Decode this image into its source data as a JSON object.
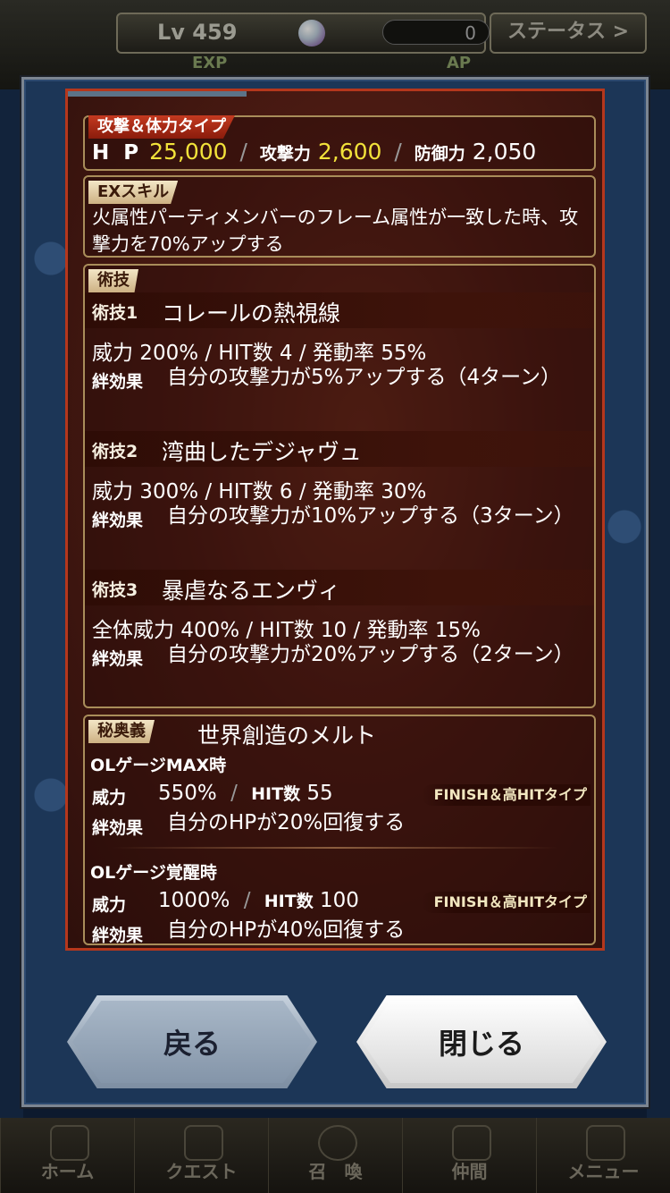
{
  "header": {
    "level": "Lv 459",
    "orb_count": "0",
    "status_label": "ステータス >",
    "exp_label": "EXP",
    "ap_label": "AP"
  },
  "dialog": {
    "type_tag": "攻撃＆体力タイプ",
    "stats": {
      "hp_label": "H P",
      "hp_value": "25,000",
      "atk_label": "攻撃力",
      "atk_value": "2,600",
      "def_label": "防御力",
      "def_value": "2,050"
    },
    "ex_skill": {
      "tag": "EXスキル",
      "text": "火属性パーティメンバーのフレーム属性が一致した時、攻撃力を70%アップする"
    },
    "arts": {
      "tag": "術技",
      "items": [
        {
          "num": "術技1",
          "name": "コレールの熱視線",
          "line": "威力 200% / HIT数 4 / 発動率 55%",
          "kizuna_label": "絆効果",
          "kizuna_text": "自分の攻撃力が5%アップする（4ターン）"
        },
        {
          "num": "術技2",
          "name": "湾曲したデジャヴュ",
          "line": "威力 300% / HIT数 6 / 発動率 30%",
          "kizuna_label": "絆効果",
          "kizuna_text": "自分の攻撃力が10%アップする（3ターン）"
        },
        {
          "num": "術技3",
          "name": "暴虐なるエンヴィ",
          "line": "全体威力 400% / HIT数 10 / 発動率 15%",
          "kizuna_label": "絆効果",
          "kizuna_text": "自分の攻撃力が20%アップする（2ターン）"
        }
      ]
    },
    "mystic": {
      "tag": "秘奥義",
      "name": "世界創造のメルト",
      "max": {
        "head": "OLゲージMAX時",
        "power_label": "威力",
        "power_value": "550%",
        "hit_label": "HIT数",
        "hit_value": "55",
        "type": "FINISH＆高HITタイプ",
        "kizuna_label": "絆効果",
        "kizuna_text": "自分のHPが20%回復する"
      },
      "awake": {
        "head": "OLゲージ覚醒時",
        "power_label": "威力",
        "power_value": "1000%",
        "hit_label": "HIT数",
        "hit_value": "100",
        "type": "FINISH＆高HITタイプ",
        "kizuna_label": "絆効果",
        "kizuna_text": "自分のHPが40%回復する"
      }
    },
    "buttons": {
      "back": "戻る",
      "close": "閉じる"
    }
  },
  "nav": [
    {
      "label": "ホーム"
    },
    {
      "label": "クエスト"
    },
    {
      "label": "召　喚"
    },
    {
      "label": "仲間"
    },
    {
      "label": "メニュー"
    }
  ],
  "colors": {
    "panel_border": "#b5371c",
    "stat_value": "#f2e23a",
    "dialog_frame": "#1c3657"
  }
}
